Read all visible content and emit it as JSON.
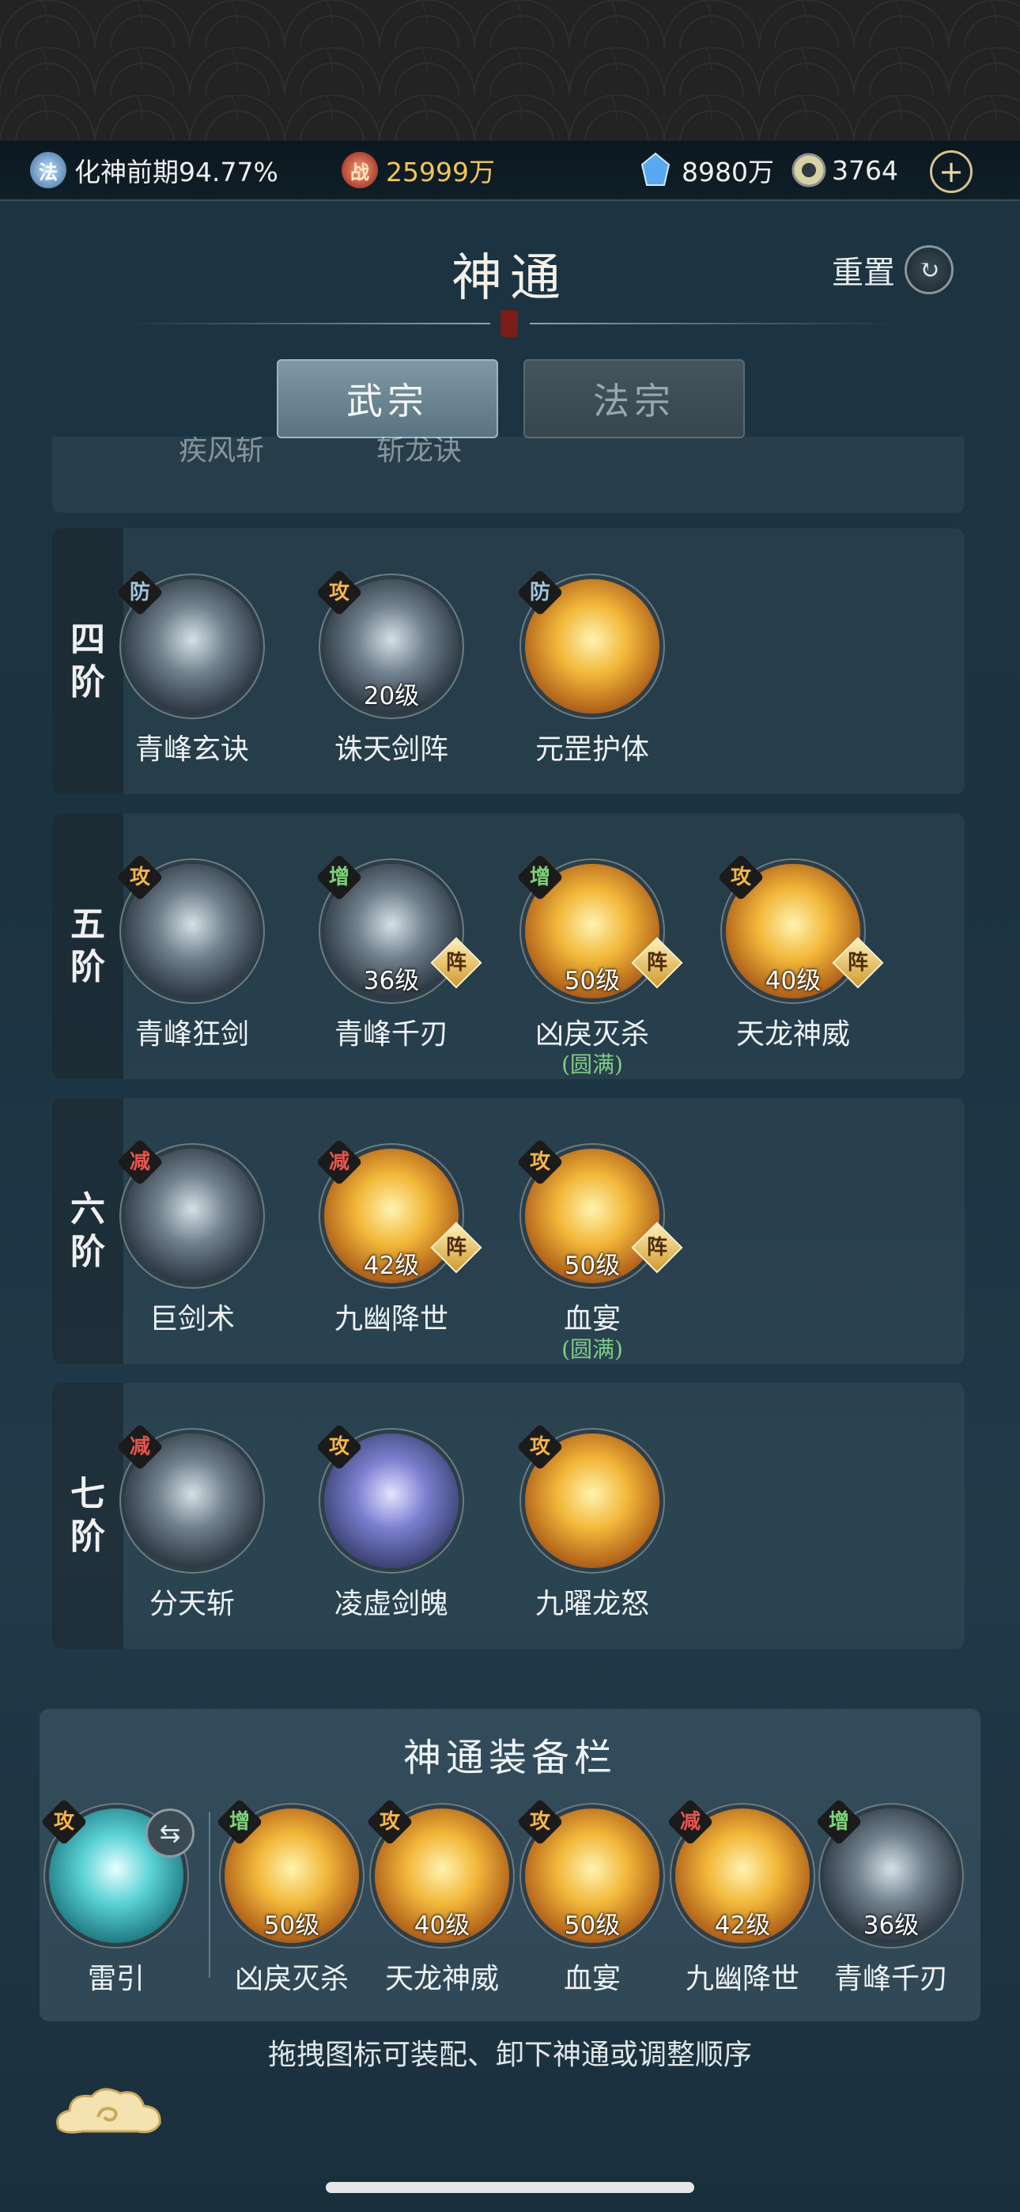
{
  "resources": {
    "realm": {
      "icon_char": "法",
      "text": "化神前期94.77%"
    },
    "power": {
      "icon_char": "战",
      "text": "25999万"
    },
    "spirit_stones": {
      "text": "8980万"
    },
    "jade": {
      "text": "3764"
    },
    "add": "+"
  },
  "header": {
    "title": "神通",
    "reset_label": "重置"
  },
  "tabs": [
    {
      "label": "武宗",
      "active": true
    },
    {
      "label": "法宗",
      "active": false
    }
  ],
  "peek_row": {
    "names": [
      "疾风斩",
      "斩龙诀"
    ]
  },
  "tiers": [
    {
      "label_chars": [
        "四",
        "阶"
      ],
      "skills": [
        {
          "name": "青峰玄诀",
          "badge": "防",
          "level": "",
          "zhen": "",
          "sub": "",
          "tone": "silver"
        },
        {
          "name": "诛天剑阵",
          "badge": "攻",
          "level": "20级",
          "zhen": "",
          "sub": "",
          "tone": "silver"
        },
        {
          "name": "元罡护体",
          "badge": "防",
          "level": "",
          "zhen": "",
          "sub": "",
          "tone": "gold"
        }
      ]
    },
    {
      "label_chars": [
        "五",
        "阶"
      ],
      "skills": [
        {
          "name": "青峰狂剑",
          "badge": "攻",
          "level": "",
          "zhen": "",
          "sub": "",
          "tone": "silver"
        },
        {
          "name": "青峰千刃",
          "badge": "增",
          "level": "36级",
          "zhen": "阵",
          "sub": "",
          "tone": "silver"
        },
        {
          "name": "凶戾灭杀",
          "badge": "增",
          "level": "50级",
          "zhen": "阵",
          "sub": "(圆满)",
          "tone": "gold"
        },
        {
          "name": "天龙神威",
          "badge": "攻",
          "level": "40级",
          "zhen": "阵",
          "sub": "",
          "tone": "gold"
        }
      ]
    },
    {
      "label_chars": [
        "六",
        "阶"
      ],
      "skills": [
        {
          "name": "巨剑术",
          "badge": "减",
          "level": "",
          "zhen": "",
          "sub": "",
          "tone": "silver"
        },
        {
          "name": "九幽降世",
          "badge": "减",
          "level": "42级",
          "zhen": "阵",
          "sub": "",
          "tone": "gold"
        },
        {
          "name": "血宴",
          "badge": "攻",
          "level": "50级",
          "zhen": "阵",
          "sub": "(圆满)",
          "tone": "gold"
        }
      ]
    },
    {
      "label_chars": [
        "七",
        "阶"
      ],
      "skills": [
        {
          "name": "分天斩",
          "badge": "减",
          "level": "",
          "zhen": "",
          "sub": "",
          "tone": "silver"
        },
        {
          "name": "凌虚剑魄",
          "badge": "攻",
          "level": "",
          "zhen": "",
          "sub": "",
          "tone": "violet"
        },
        {
          "name": "九曜龙怒",
          "badge": "攻",
          "level": "",
          "zhen": "",
          "sub": "",
          "tone": "gold"
        }
      ]
    }
  ],
  "equip": {
    "title": "神通装备栏",
    "slots": [
      {
        "name": "雷引",
        "badge": "攻",
        "level": "",
        "tone": "teal",
        "swap": "⇆"
      },
      {
        "name": "凶戾灭杀",
        "badge": "增",
        "level": "50级",
        "tone": "gold"
      },
      {
        "name": "天龙神威",
        "badge": "攻",
        "level": "40级",
        "tone": "gold"
      },
      {
        "name": "血宴",
        "badge": "攻",
        "level": "50级",
        "tone": "gold"
      },
      {
        "name": "九幽降世",
        "badge": "减",
        "level": "42级",
        "tone": "gold"
      },
      {
        "name": "青峰千刃",
        "badge": "增",
        "level": "36级",
        "tone": "silver"
      }
    ]
  },
  "hint": "拖拽图标可装配、卸下神通或调整顺序",
  "icons": {
    "realm": "realm-badge-icon",
    "power": "battle-power-icon",
    "spirit": "spirit-stone-icon",
    "jade": "jade-coin-icon",
    "reset": "reset-swirl-icon",
    "cloud": "auspicious-cloud-icon"
  },
  "colors": {
    "gold_text": "#f2c65a",
    "accent_green": "#7fcf87",
    "background": "#1d3442"
  }
}
